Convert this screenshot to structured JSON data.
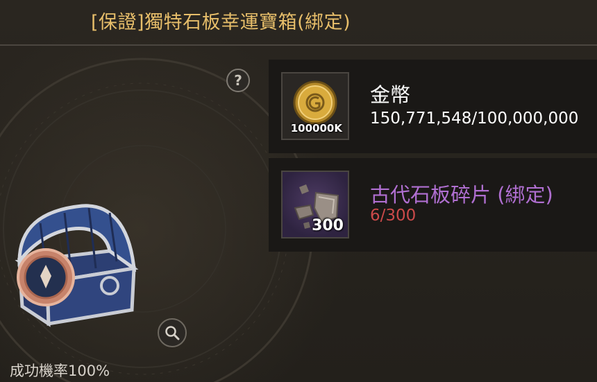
{
  "window": {
    "title": "[保證]獨特石板幸運寶箱(綁定)"
  },
  "preview": {
    "success_rate_text": "成功機率100%"
  },
  "materials": [
    {
      "name": "金幣",
      "count": "150,771,548/100,000,000",
      "quantity_badge": "100000K",
      "icon": "gold-coin-icon",
      "name_color": "#ffffff",
      "count_color": "#ffffff"
    },
    {
      "name": "古代石板碎片 (綁定)",
      "count": "6/300",
      "quantity_badge": "300",
      "icon": "stone-fragment-icon",
      "name_color": "#b06fd1",
      "count_color": "#cc4a4a"
    }
  ],
  "icons": {
    "help": "question-icon",
    "zoom": "magnifier-icon",
    "item": "treasure-chest-icon"
  },
  "colors": {
    "title": "#e7be6a",
    "panel": "#1a1816",
    "background": "#27241f"
  }
}
